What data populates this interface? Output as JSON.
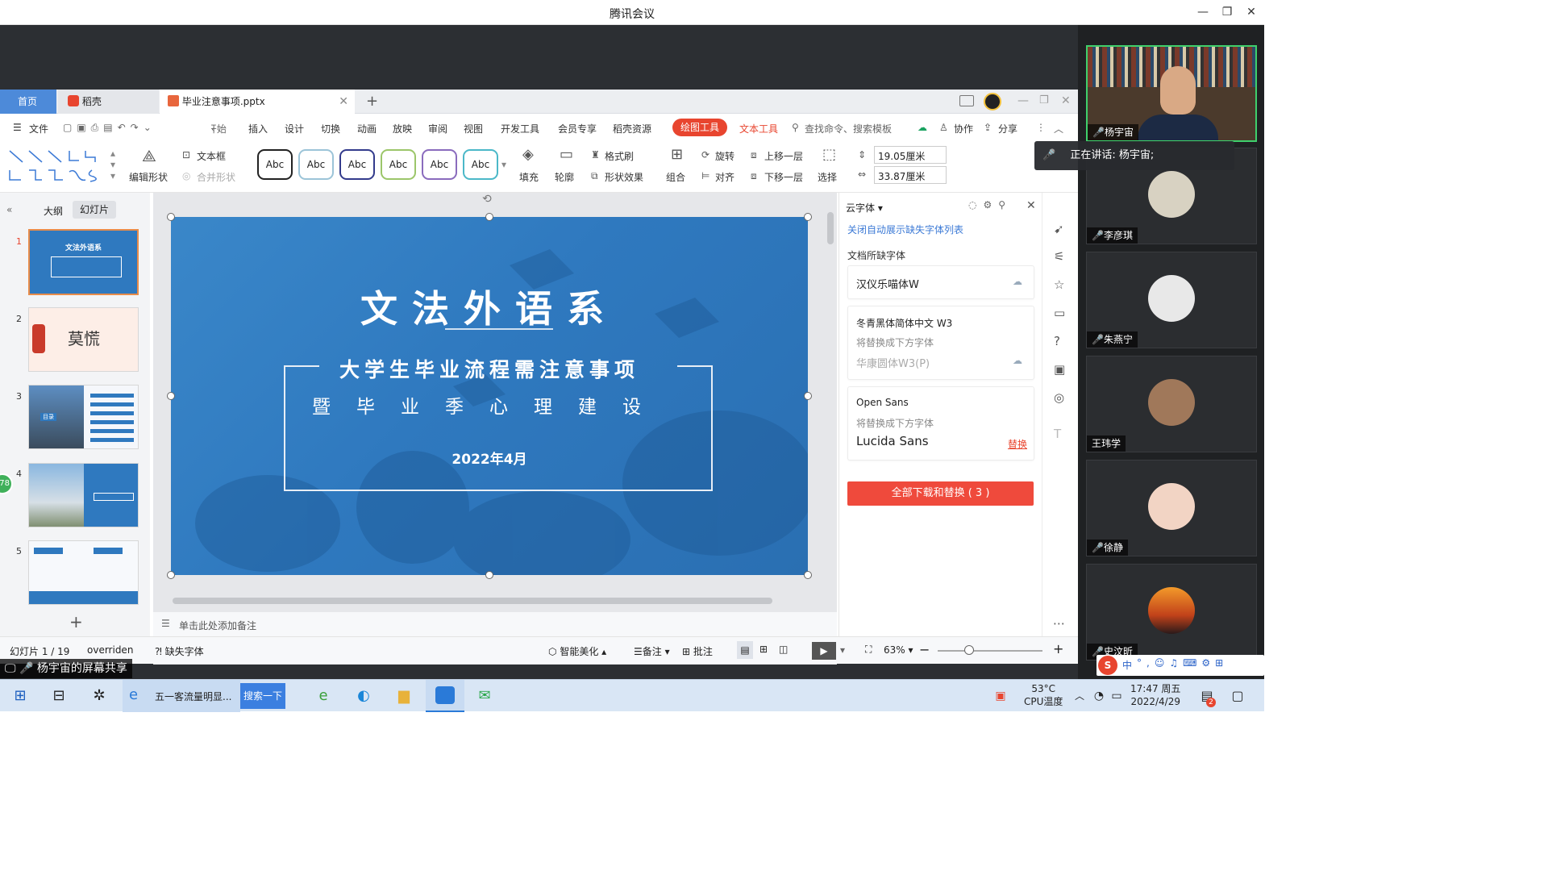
{
  "window": {
    "title": "腾讯会议"
  },
  "tabs": {
    "home": "首页",
    "docer": "稻壳",
    "file": "毕业注意事项.pptx"
  },
  "menu": {
    "file": "文件",
    "start": "开始",
    "insert": "插入",
    "design": "设计",
    "transition": "切换",
    "animation": "动画",
    "show": "放映",
    "review": "审阅",
    "view": "视图",
    "devtools": "开发工具",
    "member": "会员专享",
    "resources": "稻壳资源",
    "draw_tools": "绘图工具",
    "text_tools": "文本工具",
    "search": "查找命令、搜索模板",
    "collab": "协作",
    "share": "分享"
  },
  "ribbon": {
    "edit_shape": "编辑形状",
    "text_box": "文本框",
    "merge_shape": "合并形状",
    "style_sample": "Abc",
    "fill": "填充",
    "outline": "轮廓",
    "format_painter": "格式刷",
    "shape_effect": "形状效果",
    "group": "组合",
    "rotate": "旋转",
    "align": "对齐",
    "bring_forward": "上移一层",
    "send_backward": "下移一层",
    "select": "选择",
    "height": "19.05厘米",
    "width": "33.87厘米"
  },
  "left_pane": {
    "outline_tab": "大纲",
    "slides_tab": "幻灯片",
    "nums": [
      "1",
      "2",
      "3",
      "4",
      "5"
    ],
    "thumb2_text": "莫慌",
    "thumb1_title": "文法外语系",
    "thumb3_badge": "目录"
  },
  "slide": {
    "title": "文法外语系",
    "subtitle1": "大学生毕业流程需注意事项",
    "subtitle2": "暨毕业季心理建设",
    "date": "2022年4月"
  },
  "notes": {
    "placeholder": "单击此处添加备注"
  },
  "font_panel": {
    "header": "云字体",
    "close_auto": "关闭自动展示缺失字体列表",
    "missing_title": "文档所缺字体",
    "font1": "汉仪乐喵体W",
    "font2": "冬青黑体简体中文 W3",
    "replace_label": "将替换成下方字体",
    "font2_replace": "华康圆体W3(P)",
    "font3": "Open Sans",
    "font3_replace": "Lucida Sans",
    "replace_btn": "替换",
    "download_all": "全部下载和替换 ( 3 )"
  },
  "status": {
    "slide_count": "幻灯片 1 / 19",
    "theme": "overriden",
    "missing_font": "缺失字体",
    "beautify": "智能美化",
    "notes": "备注",
    "comment": "批注",
    "zoom": "63%"
  },
  "participants": [
    {
      "name": "杨宇宙"
    },
    {
      "name": "李彦琪"
    },
    {
      "name": "朱燕宁"
    },
    {
      "name": "王玮学"
    },
    {
      "name": "徐静"
    },
    {
      "name": "史汶昕"
    }
  ],
  "speaking": {
    "text": "正在讲话: 杨宇宙;"
  },
  "share_label": {
    "text": "杨宇宙的屏幕共享"
  },
  "badge_78": "78",
  "taskbar": {
    "app1": "五一客流量明显...",
    "search": "搜索一下",
    "temp": "53°C",
    "cpu": "CPU温度",
    "time": "17:47 周五",
    "date": "2022/4/29",
    "notif": "2"
  },
  "ime": {
    "lang": "中"
  },
  "colors": {
    "accent": "#e8452f",
    "wps_blue": "#2f79bf",
    "tab_home": "#4d8ad9"
  }
}
